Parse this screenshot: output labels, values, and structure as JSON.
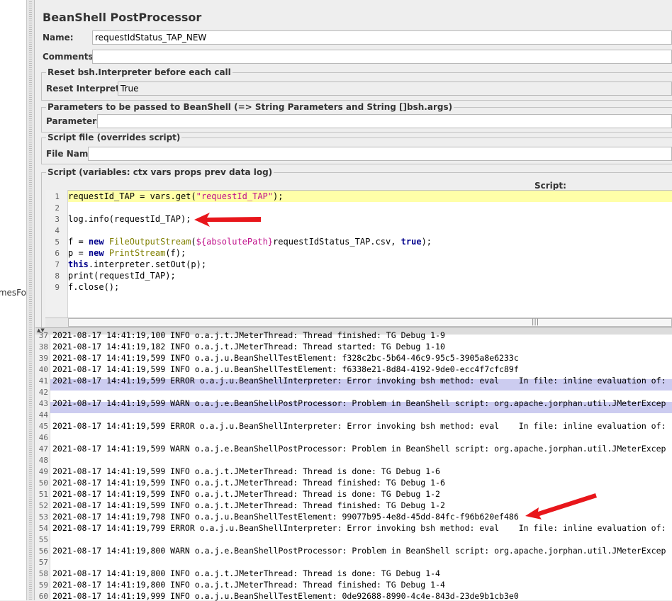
{
  "left_strip_text": "mesFo",
  "title": "BeanShell PostProcessor",
  "name_label": "Name:",
  "name_value": "requestIdStatus_TAP_NEW",
  "comments_label": "Comments:",
  "comments_value": "",
  "reset_section_title": "Reset bsh.Interpreter before each call",
  "reset_label": "Reset Interpreter:",
  "reset_value": "True",
  "params_section_title": "Parameters to be passed to BeanShell (=> String Parameters and String []bsh.args)",
  "params_label": "Parameters:",
  "params_value": "",
  "file_section_title": "Script file (overrides script)",
  "file_label": "File Name:",
  "file_value": "",
  "script_section_title": "Script (variables: ctx vars props prev data log)",
  "script_header": "Script:",
  "script_lines": [
    {
      "num": "1",
      "text": "requestId_TAP = vars.get(\"requestId_TAP\");"
    },
    {
      "num": "2",
      "text": ""
    },
    {
      "num": "3",
      "text": "log.info(requestId_TAP);"
    },
    {
      "num": "4",
      "text": ""
    },
    {
      "num": "5",
      "text": "f = new FileOutputStream(${absolutePath}requestIdStatus_TAP.csv, true);"
    },
    {
      "num": "6",
      "text": "p = new PrintStream(f);"
    },
    {
      "num": "7",
      "text": "this.interpreter.setOut(p);"
    },
    {
      "num": "8",
      "text": "print(requestId_TAP);"
    },
    {
      "num": "9",
      "text": "f.close();"
    }
  ],
  "hscroll_grip": "|||",
  "log_lines": [
    {
      "num": "37",
      "text": "2021-08-17 14:41:19,100 INFO o.a.j.t.JMeterThread: Thread finished: TG Debug 1-9"
    },
    {
      "num": "38",
      "text": "2021-08-17 14:41:19,182 INFO o.a.j.t.JMeterThread: Thread started: TG Debug 1-10"
    },
    {
      "num": "39",
      "text": "2021-08-17 14:41:19,599 INFO o.a.j.u.BeanShellTestElement: f328c2bc-5b64-46c9-95c5-3905a8e6233c"
    },
    {
      "num": "40",
      "text": "2021-08-17 14:41:19,599 INFO o.a.j.u.BeanShellTestElement: f6338e21-8d84-4192-9de0-ecc4f7cfc89f"
    },
    {
      "num": "41",
      "text": "2021-08-17 14:41:19,599 ERROR o.a.j.u.BeanShellInterpreter: Error invoking bsh method: eval    In file: inline evaluation of:"
    },
    {
      "num": "42",
      "text": ""
    },
    {
      "num": "43",
      "text": "2021-08-17 14:41:19,599 WARN o.a.j.e.BeanShellPostProcessor: Problem in BeanShell script: org.apache.jorphan.util.JMeterExcep"
    },
    {
      "num": "44",
      "text": ""
    },
    {
      "num": "45",
      "text": "2021-08-17 14:41:19,599 ERROR o.a.j.u.BeanShellInterpreter: Error invoking bsh method: eval    In file: inline evaluation of:"
    },
    {
      "num": "46",
      "text": ""
    },
    {
      "num": "47",
      "text": "2021-08-17 14:41:19,599 WARN o.a.j.e.BeanShellPostProcessor: Problem in BeanShell script: org.apache.jorphan.util.JMeterExcep"
    },
    {
      "num": "48",
      "text": ""
    },
    {
      "num": "49",
      "text": "2021-08-17 14:41:19,599 INFO o.a.j.t.JMeterThread: Thread is done: TG Debug 1-6"
    },
    {
      "num": "50",
      "text": "2021-08-17 14:41:19,599 INFO o.a.j.t.JMeterThread: Thread finished: TG Debug 1-6"
    },
    {
      "num": "51",
      "text": "2021-08-17 14:41:19,599 INFO o.a.j.t.JMeterThread: Thread is done: TG Debug 1-2"
    },
    {
      "num": "52",
      "text": "2021-08-17 14:41:19,599 INFO o.a.j.t.JMeterThread: Thread finished: TG Debug 1-2"
    },
    {
      "num": "53",
      "text": "2021-08-17 14:41:19,798 INFO o.a.j.u.BeanShellTestElement: 99077b95-4e8d-45dd-84fc-f96b620ef486"
    },
    {
      "num": "54",
      "text": "2021-08-17 14:41:19,799 ERROR o.a.j.u.BeanShellInterpreter: Error invoking bsh method: eval    In file: inline evaluation of:"
    },
    {
      "num": "55",
      "text": ""
    },
    {
      "num": "56",
      "text": "2021-08-17 14:41:19,800 WARN o.a.j.e.BeanShellPostProcessor: Problem in BeanShell script: org.apache.jorphan.util.JMeterExcep"
    },
    {
      "num": "57",
      "text": ""
    },
    {
      "num": "58",
      "text": "2021-08-17 14:41:19,800 INFO o.a.j.t.JMeterThread: Thread is done: TG Debug 1-4"
    },
    {
      "num": "59",
      "text": "2021-08-17 14:41:19,800 INFO o.a.j.t.JMeterThread: Thread finished: TG Debug 1-4"
    },
    {
      "num": "60",
      "text": "2021-08-17 14:41:19,999 INFO o.a.j.u.BeanShellTestElement: 0de92688-8990-4c4e-843d-23de9b1cb3e0"
    }
  ],
  "highlighted_log_lines": [
    "41",
    "43"
  ],
  "colors": {
    "current_line": "#ffffa8",
    "log_selection": "#ccccf0",
    "arrow": "#e8161b"
  }
}
